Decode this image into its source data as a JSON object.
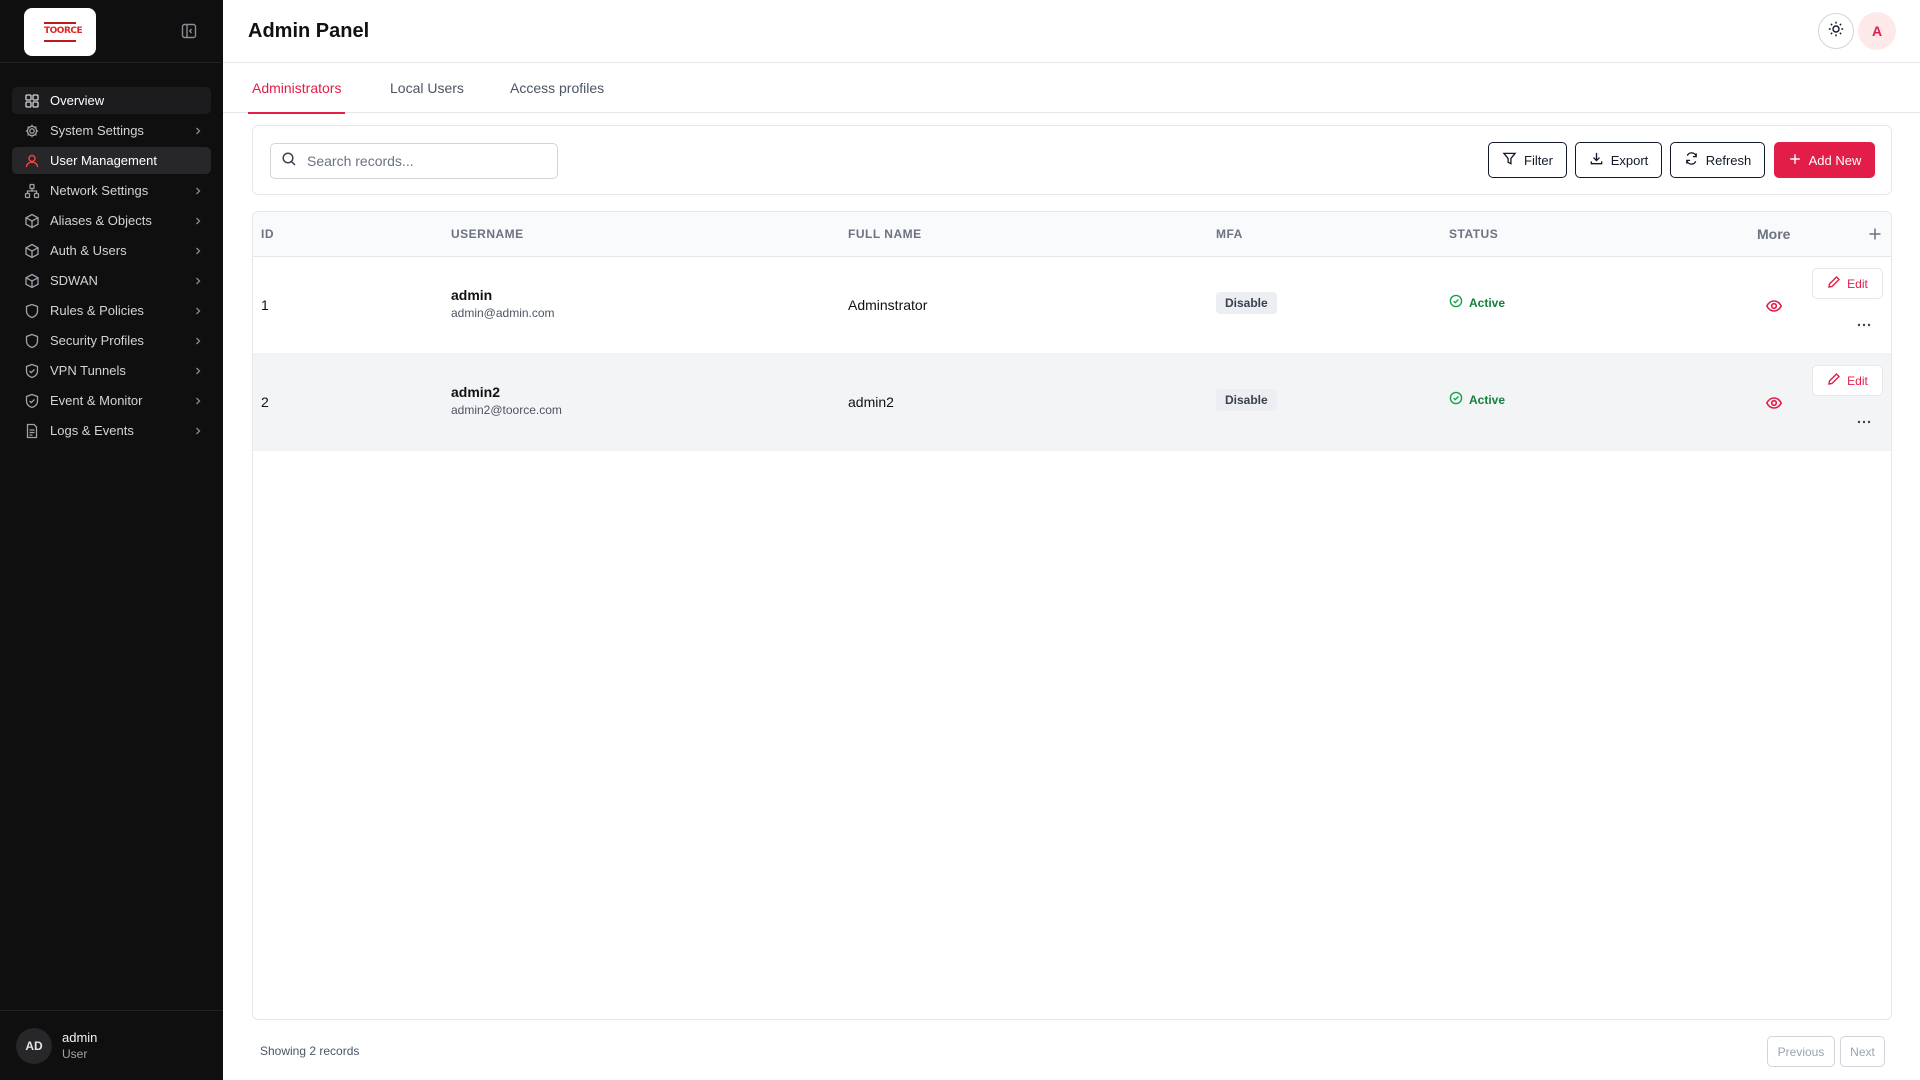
{
  "sidebar": {
    "logo_text": "TOORCE",
    "items": [
      {
        "label": "Overview",
        "icon": "grid-icon",
        "has_children": false
      },
      {
        "label": "System Settings",
        "icon": "gear-icon",
        "has_children": true
      },
      {
        "label": "User Management",
        "icon": "user-icon",
        "has_children": false
      },
      {
        "label": "Network Settings",
        "icon": "network-icon",
        "has_children": true
      },
      {
        "label": "Aliases & Objects",
        "icon": "cube-icon",
        "has_children": true
      },
      {
        "label": "Auth & Users",
        "icon": "cube-icon",
        "has_children": true
      },
      {
        "label": "SDWAN",
        "icon": "cube-icon",
        "has_children": true
      },
      {
        "label": "Rules & Policies",
        "icon": "shield-icon",
        "has_children": true
      },
      {
        "label": "Security Profiles",
        "icon": "shield-icon",
        "has_children": true
      },
      {
        "label": "VPN Tunnels",
        "icon": "shield-check-icon",
        "has_children": true
      },
      {
        "label": "Event & Monitor",
        "icon": "shield-check-icon",
        "has_children": true
      },
      {
        "label": "Logs & Events",
        "icon": "document-icon",
        "has_children": true
      }
    ],
    "active_item": "User Management",
    "user": {
      "initials": "AD",
      "name": "admin",
      "role": "User"
    }
  },
  "header": {
    "title": "Admin Panel",
    "avatar_initial": "A"
  },
  "tabs": [
    {
      "label": "Administrators",
      "active": true
    },
    {
      "label": "Local Users",
      "active": false
    },
    {
      "label": "Access profiles",
      "active": false
    }
  ],
  "toolbar": {
    "search_placeholder": "Search records...",
    "filter_label": "Filter",
    "export_label": "Export",
    "refresh_label": "Refresh",
    "add_label": "Add New"
  },
  "table": {
    "columns": {
      "id": "ID",
      "username": "USERNAME",
      "full_name": "FULL NAME",
      "mfa": "MFA",
      "status": "STATUS",
      "more": "More"
    },
    "rows": [
      {
        "id": "1",
        "username": "admin",
        "email": "admin@admin.com",
        "full_name": "Adminstrator",
        "mfa": "Disable",
        "status": "Active",
        "edit_label": "Edit"
      },
      {
        "id": "2",
        "username": "admin2",
        "email": "admin2@toorce.com",
        "full_name": "admin2",
        "mfa": "Disable",
        "status": "Active",
        "edit_label": "Edit"
      }
    ]
  },
  "footer": {
    "showing": "Showing 2 records",
    "previous": "Previous",
    "next": "Next"
  },
  "colors": {
    "accent": "#e11d48",
    "sidebar_bg": "#0f0f10",
    "status_green": "#15803d"
  }
}
